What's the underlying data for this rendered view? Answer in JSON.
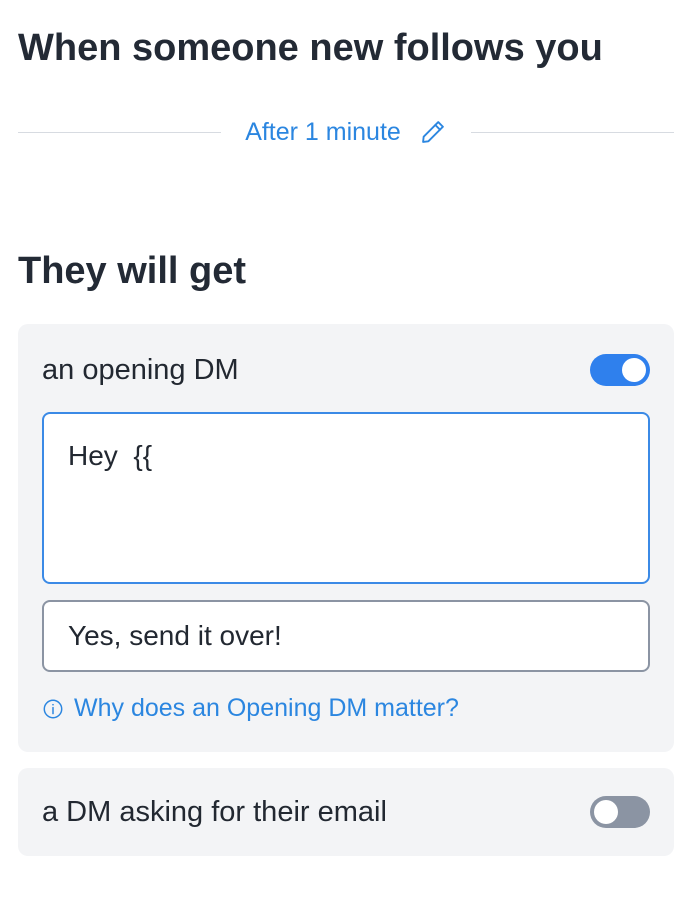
{
  "page": {
    "title": "When someone new follows you"
  },
  "delay": {
    "label": "After 1 minute",
    "icon": "pencil-icon"
  },
  "section": {
    "title": "They will get"
  },
  "opening_dm": {
    "label": "an opening DM",
    "enabled": true,
    "message": "Hey  {{",
    "button_text": "Yes, send it over!",
    "help_link": "Why does an Opening DM matter?",
    "help_icon": "info-icon"
  },
  "email_dm": {
    "label": "a DM asking for their email",
    "enabled": false
  },
  "colors": {
    "accent": "#2f80ed",
    "link": "#2b86e0",
    "toggle_off": "#8b94a3",
    "card_bg": "#f3f4f6",
    "heading": "#232a35"
  }
}
